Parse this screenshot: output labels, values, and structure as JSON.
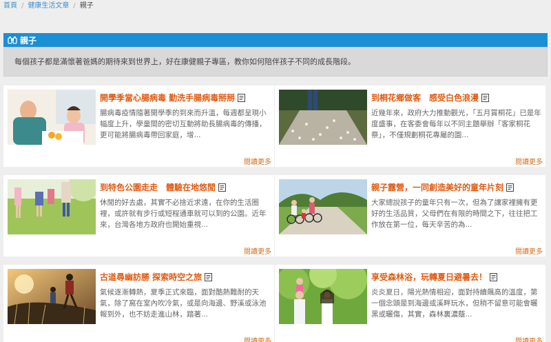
{
  "breadcrumb": {
    "home": "首頁",
    "articles": "健康生活文章",
    "current": "親子"
  },
  "section": {
    "title": "親子",
    "intro": "每個孩子都是滿懷著爸媽的期待來到世界上，好在康健親子專區，教你如何陪伴孩子不同的成長階段。"
  },
  "read_more": "閱讀更多",
  "articles": [
    {
      "title": "開學季當心腸病毒 勤洗手腸病毒掰掰",
      "excerpt": "腸病毒疫情隨著開學季的到來而升溫，每週都呈現小幅度上升，學童間的密切互動將助長腸病毒的傳播，更可能將腸病毒帶回家庭，增..."
    },
    {
      "title": "到桐花鄉做客　感受白色浪漫",
      "excerpt": "近幾年來，政府大力推動觀光，「五月賞桐花」已是年度盛事，在客委會每年以不同主題舉辦「客家桐花祭」，不僅規劃桐花專屬的園..."
    },
    {
      "title": "到特色公園走走　體驗在地悠閒",
      "excerpt": "休閒的好去處，其實不必捨近求遠，在你的生活圈裡，或許就有步行或短程通車就可以到的公園。近年來，台灣各地方政府也開始重視..."
    },
    {
      "title": "親子露營，一同創造美好的童年片刻",
      "excerpt": "大家總說孩子的童年只有一次，但為了讓家裡擁有更好的生活品質，父母們在有限的時間之下，往往把工作放在第一位，每天辛苦的為..."
    },
    {
      "title": "古道尋幽訪勝 探索時空之旅",
      "excerpt": "氣候逐漸轉熱，夏季正式來臨，面對酷熱難耐的天氣，除了窩在室內吹冷氣，或是向海邊、野溪或泳池報到外，也不妨走進山林，踏著..."
    },
    {
      "title": "享受森林浴，玩轉夏日避暑去！",
      "excerpt": "炎炎夏日，陽光熱情相迎，面對持續飆高的溫度，第一個念頭是到海邊或溪畔玩水，但稍不留意可能會曬黑或曬傷，其實，森林裏濃蔭..."
    }
  ]
}
